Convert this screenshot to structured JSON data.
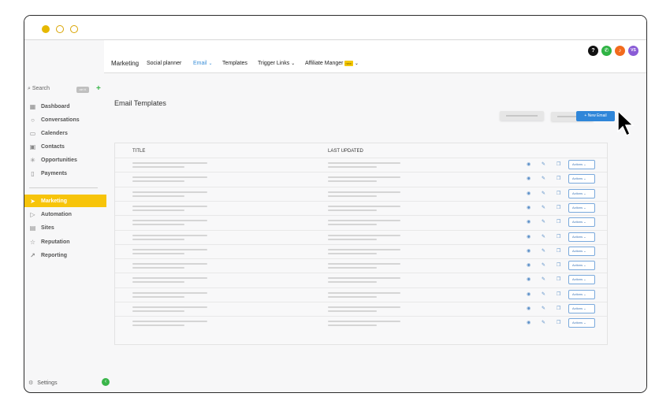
{
  "window": {
    "dots": [
      "filled",
      "outline",
      "outline"
    ]
  },
  "topnav": {
    "brand": "Marketing",
    "items": [
      {
        "label": "Social planner",
        "active": false
      },
      {
        "label": "Email",
        "active": true
      },
      {
        "label": "Templates",
        "active": false
      },
      {
        "label": "Trigger Links",
        "active": false
      },
      {
        "label": "Affiliate Manger",
        "active": false
      }
    ],
    "new_badge": "new",
    "header_icons": [
      {
        "name": "help-icon",
        "glyph": "?",
        "color": "#111111"
      },
      {
        "name": "phone-icon",
        "glyph": "✆",
        "color": "#2fb344"
      },
      {
        "name": "notification-icon",
        "glyph": "🔔",
        "color": "#f26b1d"
      },
      {
        "name": "avatar",
        "glyph": "VS",
        "color": "#8a5cd6"
      }
    ]
  },
  "sidebar": {
    "search_placeholder": "Search",
    "search_shortcut": "ctrl K",
    "items_top": [
      {
        "label": "Dashboard",
        "icon": "dashboard-icon"
      },
      {
        "label": "Conversations",
        "icon": "chat-icon"
      },
      {
        "label": "Calenders",
        "icon": "calendar-icon"
      },
      {
        "label": "Contacts",
        "icon": "contacts-icon"
      },
      {
        "label": "Opportunities",
        "icon": "opportunities-icon"
      },
      {
        "label": "Payments",
        "icon": "payments-icon"
      }
    ],
    "items_bottom": [
      {
        "label": "Marketing",
        "icon": "marketing-icon",
        "active": true
      },
      {
        "label": "Automation",
        "icon": "automation-icon"
      },
      {
        "label": "Sites",
        "icon": "sites-icon"
      },
      {
        "label": "Reputation",
        "icon": "star-icon"
      },
      {
        "label": "Reporting",
        "icon": "reporting-icon"
      }
    ],
    "settings": "Settings"
  },
  "main": {
    "title": "Email Templates",
    "new_button": "+ New Email",
    "table": {
      "columns": [
        "TITLE",
        "LAST UPDATED"
      ],
      "row_count": 12,
      "action_label": "Actions"
    }
  },
  "colors": {
    "accent": "#f7c40a",
    "primary": "#2f86d9"
  }
}
